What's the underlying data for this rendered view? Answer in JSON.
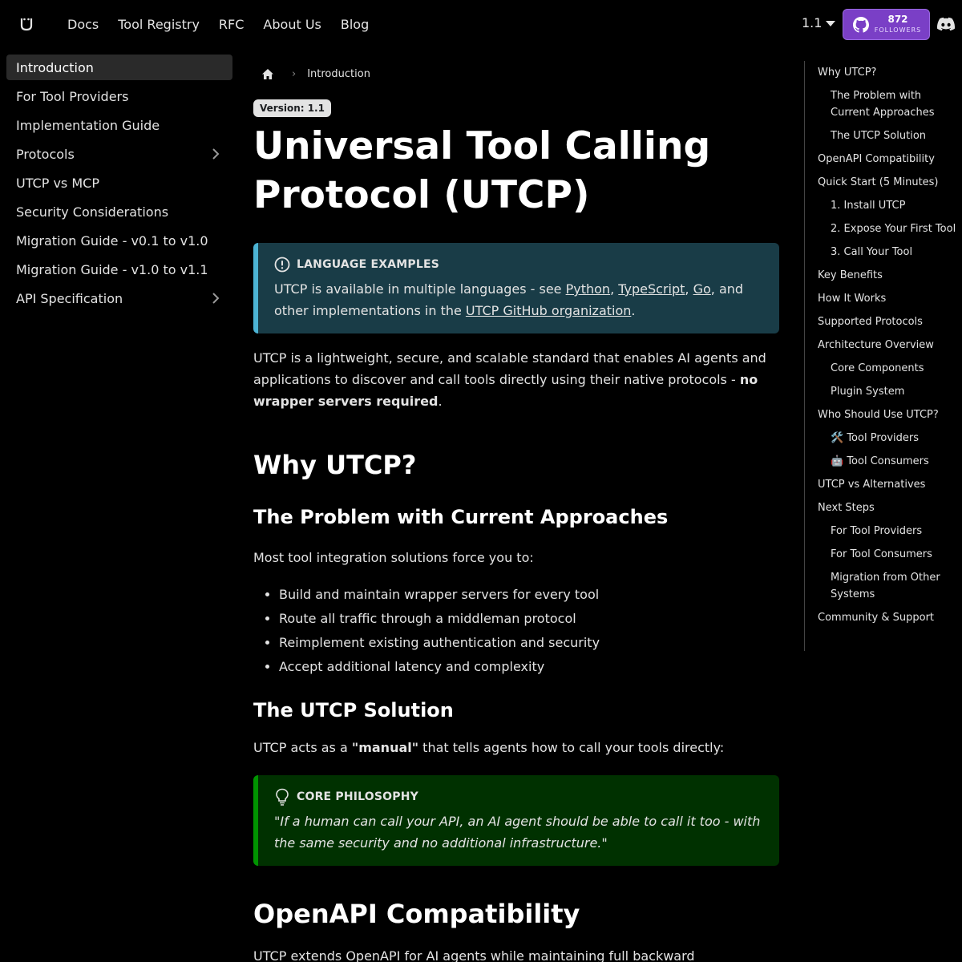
{
  "navbar": {
    "links": [
      "Docs",
      "Tool Registry",
      "RFC",
      "About Us",
      "Blog"
    ],
    "version": "1.1",
    "github": {
      "count": "872",
      "label": "FOLLOWERS"
    }
  },
  "sidebar": {
    "items": [
      {
        "label": "Introduction",
        "active": true
      },
      {
        "label": "For Tool Providers"
      },
      {
        "label": "Implementation Guide"
      },
      {
        "label": "Protocols",
        "expandable": true
      },
      {
        "label": "UTCP vs MCP"
      },
      {
        "label": "Security Considerations"
      },
      {
        "label": "Migration Guide - v0.1 to v1.0"
      },
      {
        "label": "Migration Guide - v1.0 to v1.1"
      },
      {
        "label": "API Specification",
        "expandable": true
      }
    ]
  },
  "breadcrumb": {
    "current": "Introduction"
  },
  "main": {
    "version_badge": "Version: 1.1",
    "title": "Universal Tool Calling Protocol (UTCP)",
    "info": {
      "heading": "LANGUAGE EXAMPLES",
      "text_1": "UTCP is available in multiple languages - see ",
      "link_python": "Python",
      "sep_1": ", ",
      "link_typescript": "TypeScript",
      "sep_2": ", ",
      "link_go": "Go",
      "text_2": ", and other implementations in the ",
      "link_github": "UTCP GitHub organization",
      "text_3": "."
    },
    "intro_1": "UTCP is a lightweight, secure, and scalable standard that enables AI agents and applications to discover and call tools directly using their native protocols - ",
    "intro_bold": "no wrapper servers required",
    "intro_2": ".",
    "h_why": "Why UTCP?",
    "h_problem": "The Problem with Current Approaches",
    "problem_intro": "Most tool integration solutions force you to:",
    "problem_items": [
      "Build and maintain wrapper servers for every tool",
      "Route all traffic through a middleman protocol",
      "Reimplement existing authentication and security",
      "Accept additional latency and complexity"
    ],
    "h_solution": "The UTCP Solution",
    "solution_1": "UTCP acts as a ",
    "solution_bold": "\"manual\"",
    "solution_2": " that tells agents how to call your tools directly:",
    "tip": {
      "heading": "CORE PHILOSOPHY",
      "quote": "\"If a human can call your API, an AI agent should be able to call it too - with the same security and no additional infrastructure.\""
    },
    "h_openapi": "OpenAPI Compatibility",
    "openapi_text": "UTCP extends OpenAPI for AI agents while maintaining full backward compatibility."
  },
  "toc": [
    {
      "label": "Why UTCP?",
      "level": 1
    },
    {
      "label": "The Problem with Current Approaches",
      "level": 2
    },
    {
      "label": "The UTCP Solution",
      "level": 2
    },
    {
      "label": "OpenAPI Compatibility",
      "level": 1
    },
    {
      "label": "Quick Start (5 Minutes)",
      "level": 1
    },
    {
      "label": "1. Install UTCP",
      "level": 2
    },
    {
      "label": "2. Expose Your First Tool",
      "level": 2
    },
    {
      "label": "3. Call Your Tool",
      "level": 2
    },
    {
      "label": "Key Benefits",
      "level": 1
    },
    {
      "label": "How It Works",
      "level": 1
    },
    {
      "label": "Supported Protocols",
      "level": 1
    },
    {
      "label": "Architecture Overview",
      "level": 1
    },
    {
      "label": "Core Components",
      "level": 2
    },
    {
      "label": "Plugin System",
      "level": 2
    },
    {
      "label": "Who Should Use UTCP?",
      "level": 1
    },
    {
      "label": "🛠️ Tool Providers",
      "level": 2
    },
    {
      "label": "🤖 Tool Consumers",
      "level": 2
    },
    {
      "label": "UTCP vs Alternatives",
      "level": 1
    },
    {
      "label": "Next Steps",
      "level": 1
    },
    {
      "label": "For Tool Providers",
      "level": 2
    },
    {
      "label": "For Tool Consumers",
      "level": 2
    },
    {
      "label": "Migration from Other Systems",
      "level": 2
    },
    {
      "label": "Community & Support",
      "level": 1
    }
  ]
}
